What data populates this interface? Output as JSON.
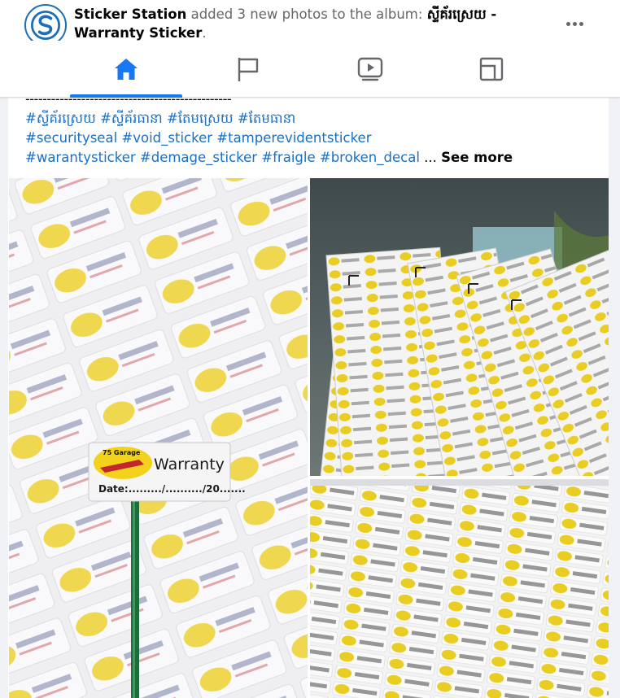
{
  "post": {
    "page_name": "Sticker Station",
    "action_text": " added 3 new photos to the album: ",
    "album_name": "ស្ទីគ័រស្រេយ - Warranty Sticker",
    "period": "."
  },
  "nav": {
    "tabs": [
      {
        "name": "home",
        "icon": "home-icon",
        "active": true
      },
      {
        "name": "pages",
        "icon": "flag-icon",
        "active": false
      },
      {
        "name": "watch",
        "icon": "video-play-icon",
        "active": false
      },
      {
        "name": "gaming",
        "icon": "gaming-icon",
        "active": false
      }
    ],
    "accent_color": "#1877f2"
  },
  "content": {
    "dash_line": "------------------------------------------------",
    "hashtag_line_1": [
      "#ស្ទីគ័រស្រេយ",
      "#ស្ទីគ័រធានា",
      "#តែមស្រេយ",
      "#តែមធានា"
    ],
    "hashtag_line_2": [
      "#securityseal",
      "#void_sticker",
      "#tamperevidentsticker"
    ],
    "hashtag_line_3": [
      "#warantysticker",
      "#demage_sticker",
      "#fraigle",
      "#broken_decal"
    ],
    "ellipsis": "...",
    "see_more": "See more"
  },
  "photos": {
    "sticker_brand": "75 Garage",
    "sticker_title": "Warranty",
    "sticker_date": "Date:........./........../20.......",
    "colors": {
      "sticker_yellow": "#f2d21a",
      "sticker_red": "#c4262e",
      "sheet_white": "#f4f4f4",
      "pole_green": "#1e6b3c"
    }
  }
}
